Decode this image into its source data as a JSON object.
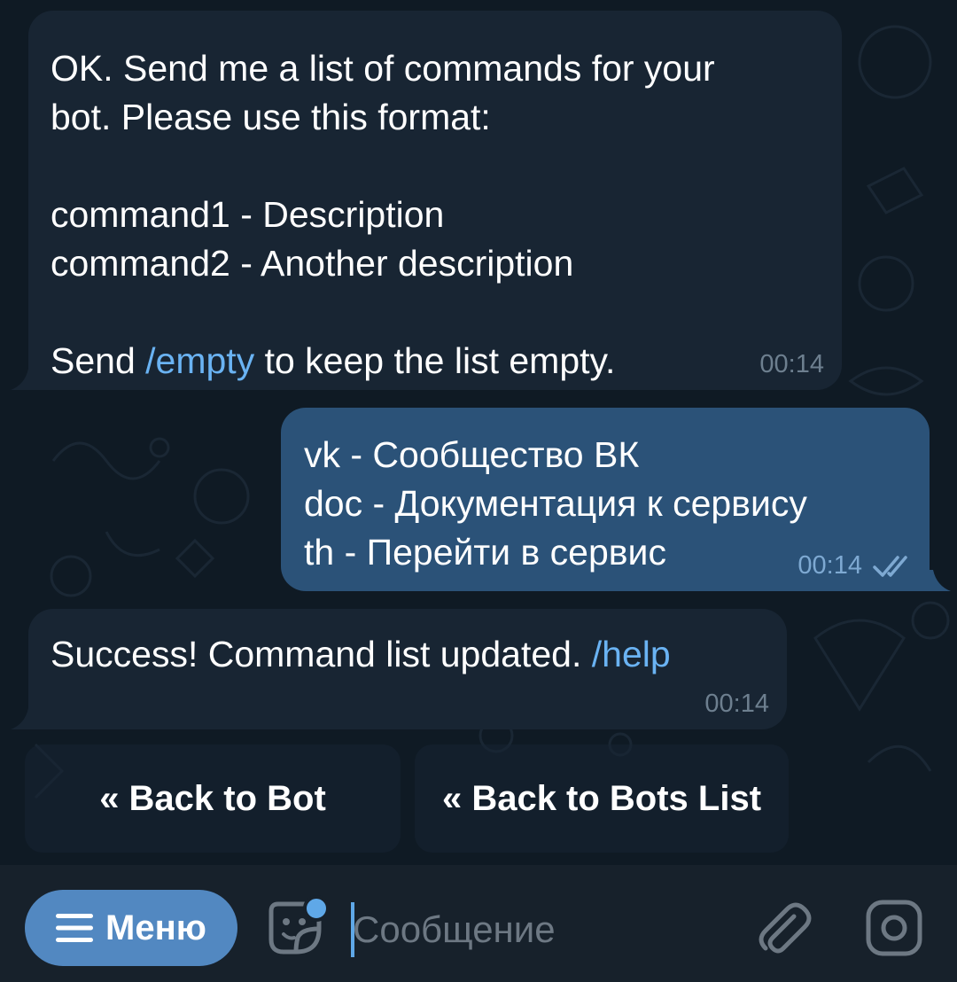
{
  "messages": [
    {
      "id": "msg1",
      "direction": "incoming",
      "lines": [
        "OK. Send me a list of commands for your",
        "bot. Please use this format:",
        "",
        "command1 - Description",
        "command2 - Another description",
        ""
      ],
      "last_line": {
        "before": "Send ",
        "command": "/empty",
        "after": " to keep the list empty."
      },
      "time": "00:14"
    },
    {
      "id": "msg2",
      "direction": "outgoing",
      "lines": [
        "vk - Сообщество ВК",
        "doc - Документация к сервису",
        "th - Перейти в сервис"
      ],
      "time": "00:14",
      "status": "read"
    },
    {
      "id": "msg3",
      "direction": "incoming",
      "text": "Success! Command list updated. ",
      "command": "/help",
      "time": "00:14"
    }
  ],
  "keyboard": {
    "buttons": [
      "« Back to Bot",
      "« Back to Bots List"
    ]
  },
  "composer": {
    "menu_label": "Меню",
    "placeholder": "Сообщение",
    "icons": [
      "menu-icon",
      "sticker-icon",
      "attach-icon",
      "camera-icon"
    ]
  },
  "colors": {
    "background": "#0e1621",
    "incoming_bubble": "#182533",
    "outgoing_bubble": "#2b5278",
    "link": "#6ab3f3",
    "accent": "#5288c1"
  }
}
